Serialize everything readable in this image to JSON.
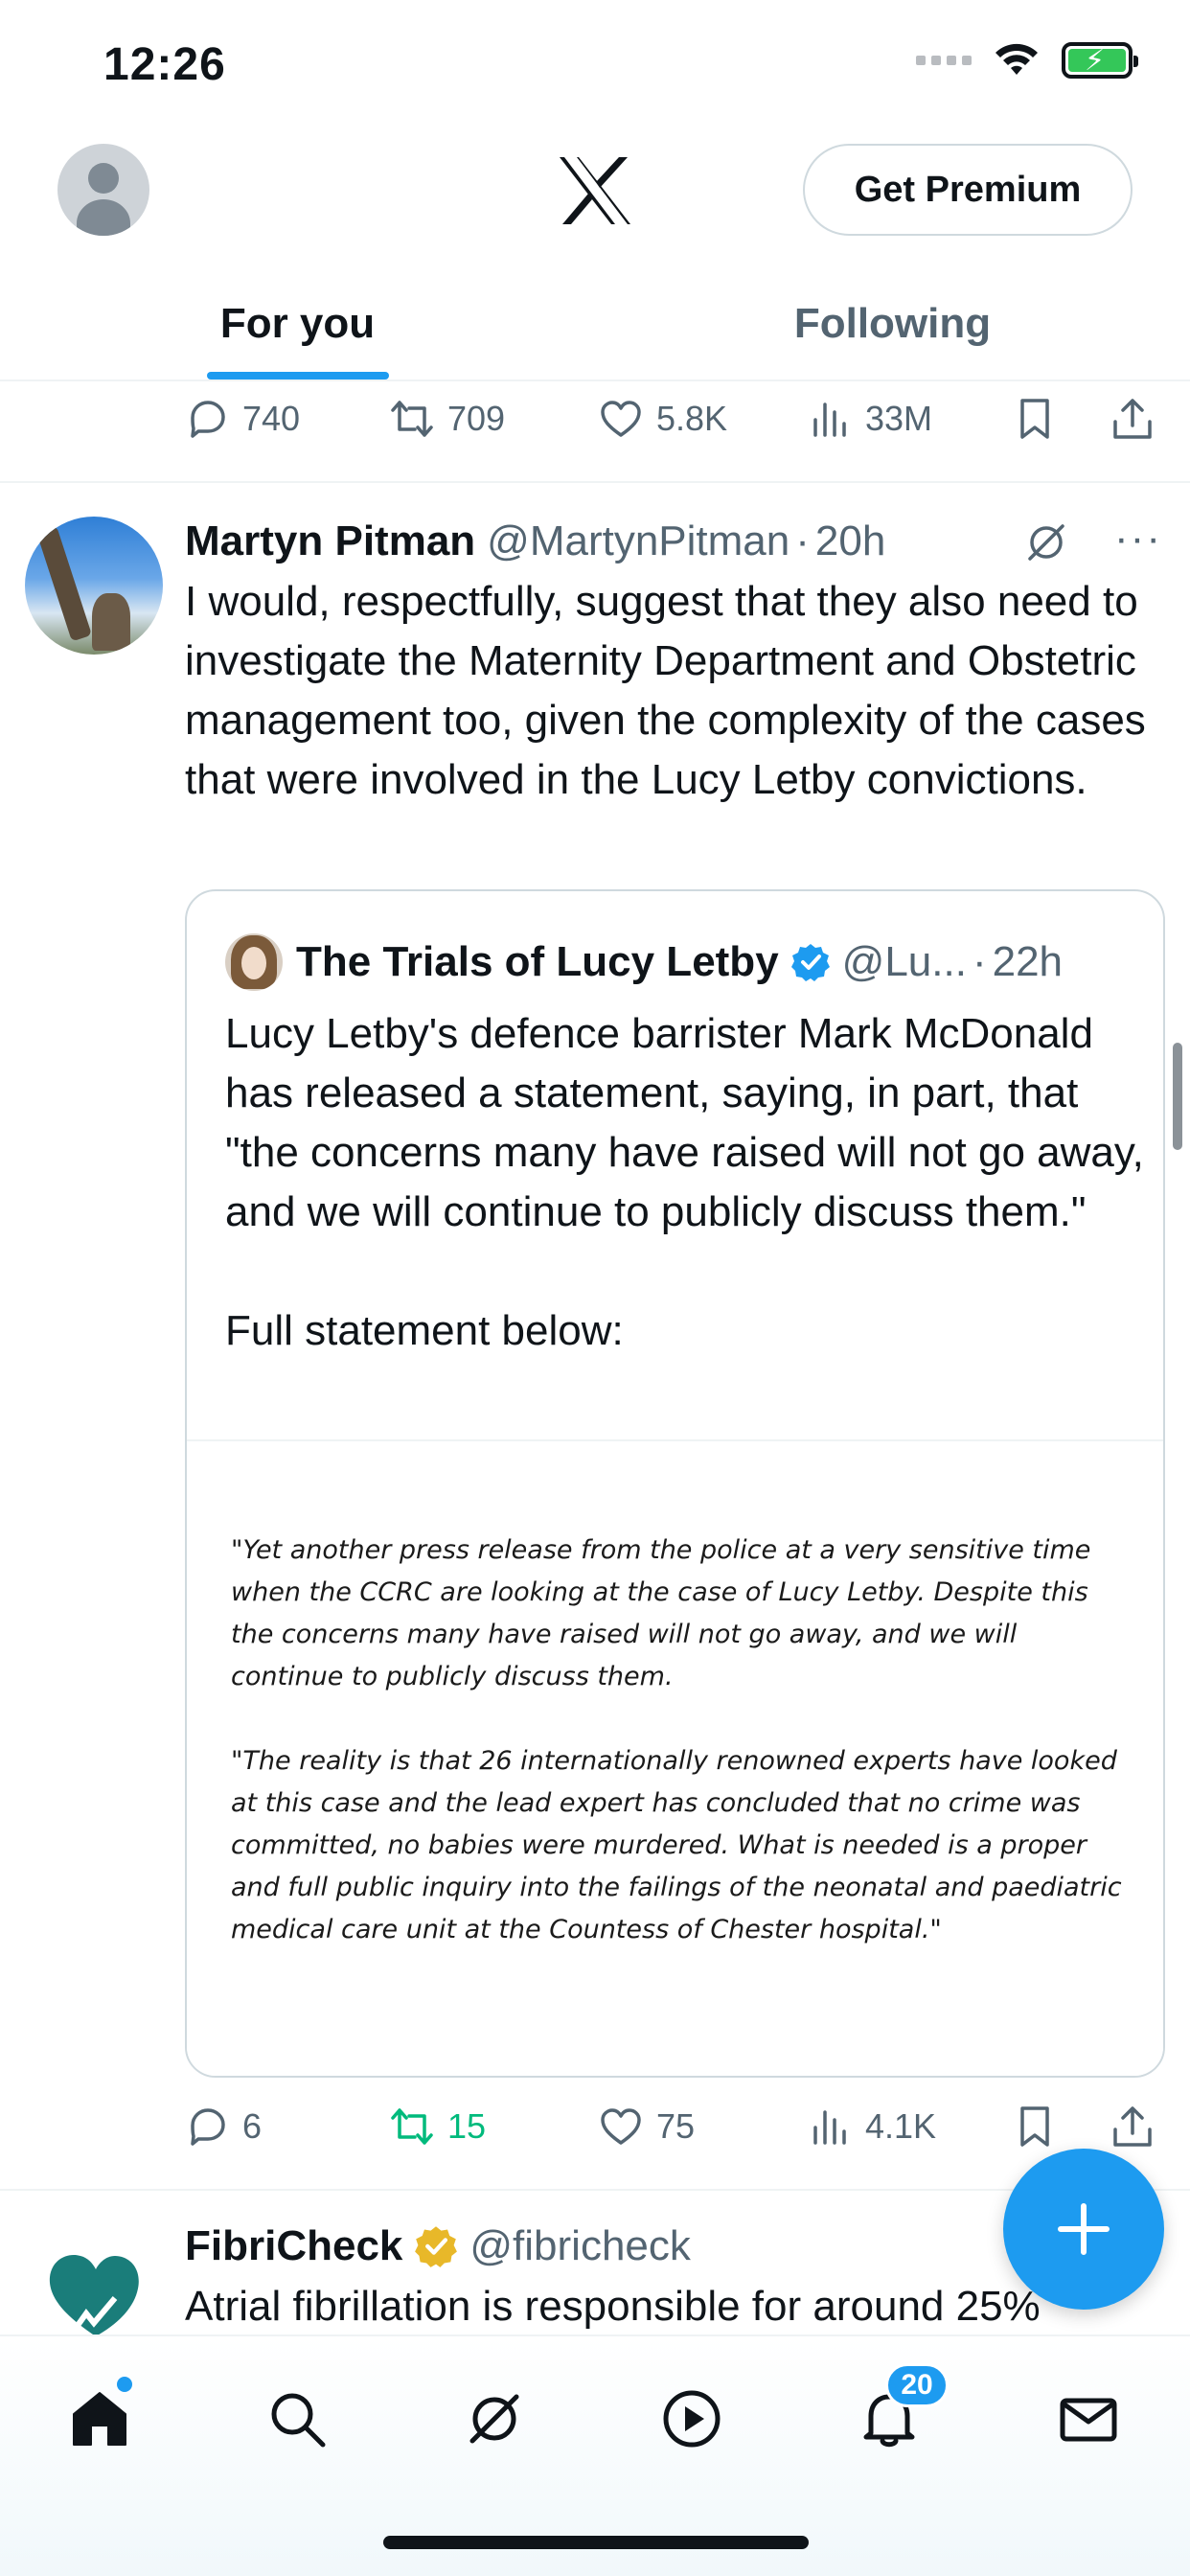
{
  "status_bar": {
    "time": "12:26"
  },
  "header": {
    "premium_label": "Get Premium"
  },
  "tabs": [
    {
      "label": "For you",
      "active": true
    },
    {
      "label": "Following",
      "active": false
    }
  ],
  "prev_tweet_metrics": {
    "replies": "740",
    "reposts": "709",
    "likes": "5.8K",
    "views": "33M"
  },
  "tweet": {
    "name": "Martyn Pitman",
    "handle": "@MartynPitman",
    "dot": "·",
    "time": "20h",
    "text": "I would, respectfully, suggest that they also need to investigate the Maternity Department and Obstetric management too, given the complexity of the cases that were involved in the Lucy Letby convictions.",
    "quote": {
      "name": "The Trials of Lucy Letby",
      "handle": "@Lu...",
      "dot": "·",
      "time": "22h",
      "text": "Lucy Letby's defence barrister Mark McDonald has released a statement, saying, in part, that \"the concerns many have raised will not go away, and we will continue to publicly discuss them.\"\n\nFull statement below:",
      "image_text_1": "\"Yet another press release from the police at a very sensitive time when the CCRC are looking at the case of Lucy Letby. Despite this the concerns many have raised will not go away, and we will continue to publicly discuss them.",
      "image_text_2": "\"The reality is that 26 internationally renowned experts have looked at this case and the lead expert has concluded that no crime was committed, no babies were murdered. What is needed is a proper and full public inquiry into the failings of the neonatal and paediatric medical care unit at the Countess of Chester hospital.\""
    },
    "metrics": {
      "replies": "6",
      "reposts": "15",
      "likes": "75",
      "views": "4.1K"
    }
  },
  "next_tweet": {
    "name": "FibriCheck",
    "handle": "@fibricheck",
    "text": "Atrial fibrillation is responsible for around 25%"
  },
  "bottom_nav": {
    "notifications_badge": "20"
  },
  "colors": {
    "accent": "#1d9bf0",
    "repost_active": "#00ba7c",
    "verified_gold": "#e8b829"
  }
}
